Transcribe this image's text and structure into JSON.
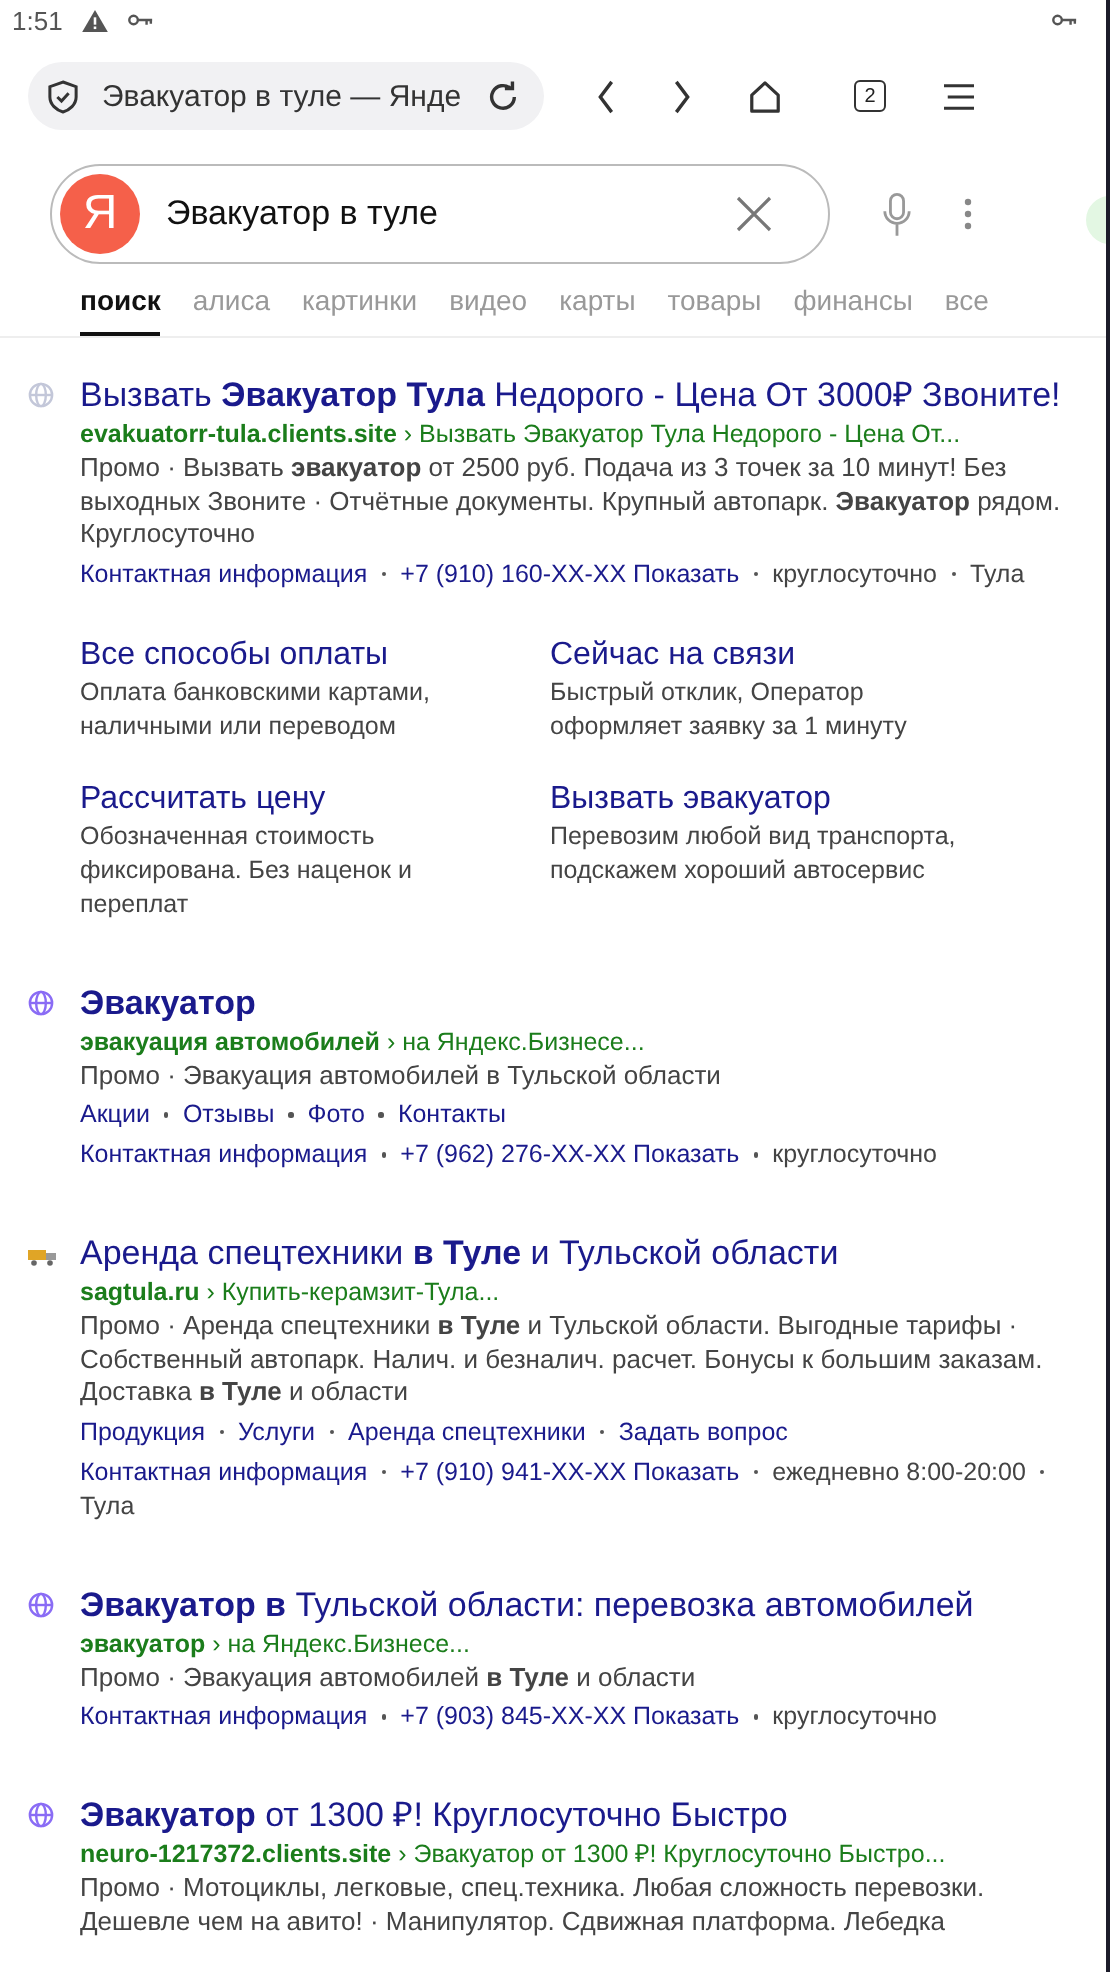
{
  "status_bar": {
    "time": "1:51"
  },
  "browser": {
    "address": "Эвакуатор в туле — Янде",
    "tab_count": "2"
  },
  "search": {
    "logo": "Я",
    "query": "Эвакуатор в туле"
  },
  "tabs": [
    {
      "label": "поиск",
      "selected": true
    },
    {
      "label": "алиса",
      "selected": false
    },
    {
      "label": "картинки",
      "selected": false
    },
    {
      "label": "видео",
      "selected": false
    },
    {
      "label": "карты",
      "selected": false
    },
    {
      "label": "товары",
      "selected": false
    },
    {
      "label": "финансы",
      "selected": false
    },
    {
      "label": "все",
      "selected": false
    }
  ],
  "results": [
    {
      "favicon": {
        "kind": "globe",
        "color": "#c3c7d9"
      },
      "title": "Вызвать **Эвакуатор Тула** Недорого - Цена От 3000₽ Звоните!",
      "domain": "evakuatorr-tula.clients.site",
      "path": "› Вызвать Эвакуатор Тула Недорого - Цена От...",
      "text": "Промо · Вызвать **эвакуатор** от 2500 руб. Подача из 3 точек за 10 минут! Без выходных Звоните · Отчётные документы. Крупный автопарк. **Эвакуатор** рядом. Круглосуточно",
      "rows": [
        {
          "items": [
            {
              "kind": "link",
              "text": "Контактная информация"
            },
            {
              "kind": "link",
              "text": "+7 (910) 160-XX-XX Показать"
            },
            {
              "kind": "text",
              "text": "круглосуточно"
            },
            {
              "kind": "text",
              "text": "Тула"
            }
          ]
        }
      ],
      "sitelinks": [
        {
          "title": "Все способы оплаты",
          "text": "Оплата банковскими картами, наличными или переводом"
        },
        {
          "title": "Сейчас на связи",
          "text": "Быстрый отклик, Оператор оформляет заявку за 1 минуту"
        },
        {
          "title": "Рассчитать цену",
          "text": "Обозначенная стоимость фиксирована. Без наценок и переплат"
        },
        {
          "title": "Вызвать эвакуатор",
          "text": "Перевозим любой вид транспорта, подскажем хороший автосервис"
        }
      ]
    },
    {
      "favicon": {
        "kind": "globe",
        "color": "#8a6cf5"
      },
      "title": "**Эвакуатор**",
      "domain": "эвакуация автомобилей",
      "path": "› на Яндекс.Бизнесе...",
      "text": "Промо · Эвакуация автомобилей в Тульской области",
      "rows": [
        {
          "items": [
            {
              "kind": "link",
              "text": "Акции"
            },
            {
              "kind": "link",
              "text": "Отзывы"
            },
            {
              "kind": "link",
              "text": "Фото"
            },
            {
              "kind": "link",
              "text": "Контакты"
            }
          ]
        },
        {
          "items": [
            {
              "kind": "link",
              "text": "Контактная информация"
            },
            {
              "kind": "link",
              "text": "+7 (962) 276-XX-XX Показать"
            },
            {
              "kind": "text",
              "text": "круглосуточно"
            }
          ]
        }
      ]
    },
    {
      "favicon": {
        "kind": "logo",
        "color": "#e0a526"
      },
      "title": "Аренда спецтехники **в Туле** и Тульской области",
      "domain": "sagtula.ru",
      "path": "› Купить-керамзит-Тула...",
      "text": "Промо · Аренда спецтехники **в Туле** и Тульской области. Выгодные тарифы · Собственный автопарк. Налич. и безналич. расчет. Бонусы к большим заказам. Доставка **в Туле** и области",
      "rows": [
        {
          "items": [
            {
              "kind": "link",
              "text": "Продукция"
            },
            {
              "kind": "link",
              "text": "Услуги"
            },
            {
              "kind": "link",
              "text": "Аренда спецтехники"
            },
            {
              "kind": "link",
              "text": "Задать вопрос"
            }
          ]
        },
        {
          "items": [
            {
              "kind": "link",
              "text": "Контактная информация"
            },
            {
              "kind": "link",
              "text": "+7 (910) 941-XX-XX Показать"
            },
            {
              "kind": "text",
              "text": "ежедневно 8:00-20:00"
            },
            {
              "kind": "text",
              "text": "Тула"
            }
          ]
        }
      ]
    },
    {
      "favicon": {
        "kind": "globe",
        "color": "#8a6cf5"
      },
      "title": "**Эвакуатор в** Тульской области: перевозка автомобилей",
      "domain": "эвакуатор",
      "path": "› на Яндекс.Бизнесе...",
      "text": "Промо · Эвакуация автомобилей **в Туле** и области",
      "rows": [
        {
          "items": [
            {
              "kind": "link",
              "text": "Контактная информация"
            },
            {
              "kind": "link",
              "text": "+7 (903) 845-XX-XX Показать"
            },
            {
              "kind": "text",
              "text": "круглосуточно"
            }
          ]
        }
      ]
    },
    {
      "favicon": {
        "kind": "globe",
        "color": "#8a6cf5"
      },
      "title": "**Эвакуатор** от 1300 ₽! Круглосуточно Быстро",
      "domain": "neuro-1217372.clients.site",
      "path": "› Эвакуатор от 1300 ₽! Круглосуточно Быстро...",
      "text": "Промо · Мотоциклы, легковые, спец.техника. Любая сложность перевозки. Дешевле чем на авито! · Манипулятор. Сдвижная платформа. Лебедка"
    }
  ]
}
